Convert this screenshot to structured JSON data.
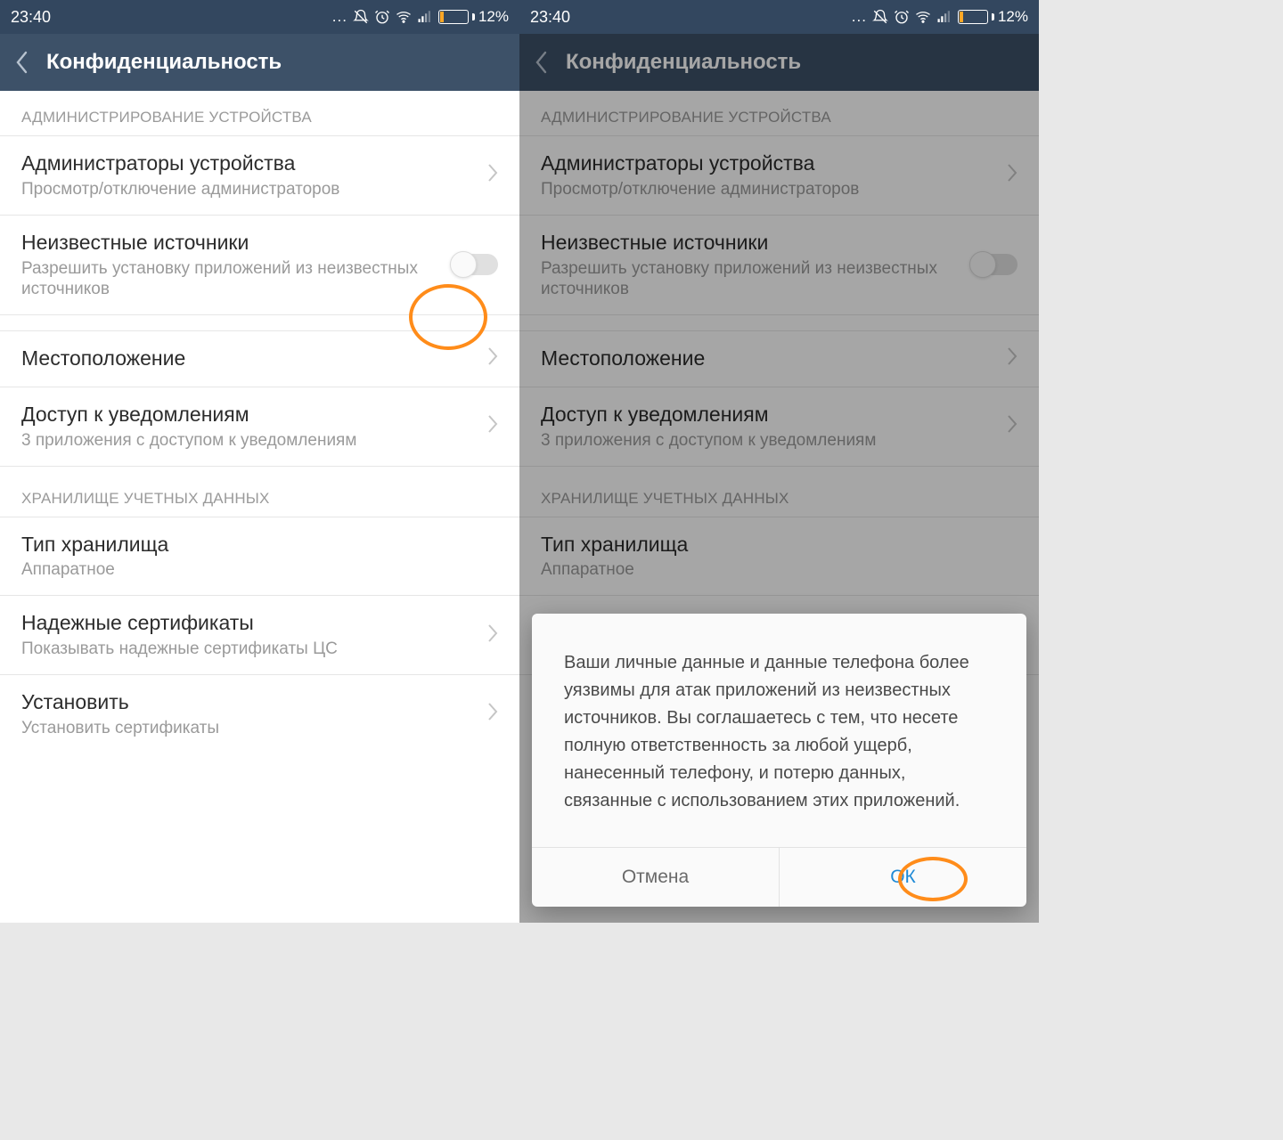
{
  "status": {
    "time": "23:40",
    "battery": "12%",
    "dots": "..."
  },
  "header": {
    "title": "Конфиденциальность"
  },
  "section1": "АДМИНИСТРИРОВАНИЕ УСТРОЙСТВА",
  "item_admins": {
    "title": "Администраторы устройства",
    "sub": "Просмотр/отключение администраторов"
  },
  "item_unknown": {
    "title": "Неизвестные источники",
    "sub": "Разрешить установку приложений из неизвестных источников"
  },
  "item_location": {
    "title": "Местоположение"
  },
  "item_notif": {
    "title": "Доступ к уведомлениям",
    "sub": "3 приложения с доступом к уведомлениям"
  },
  "section2": "ХРАНИЛИЩЕ УЧЕТНЫХ ДАННЫХ",
  "item_storage": {
    "title": "Тип хранилища",
    "sub": "Аппаратное"
  },
  "item_certs": {
    "title": "Надежные сертификаты",
    "sub": "Показывать надежные сертификаты ЦС"
  },
  "item_install": {
    "title": "Установить",
    "sub": "Установить сертификаты"
  },
  "dialog": {
    "body": "Ваши личные данные и данные телефона более уязвимы для атак приложений из неизвестных источников. Вы соглашаетесь с тем, что несете полную ответственность за любой ущерб, нанесенный телефону, и потерю данных, связанные с использованием этих приложений.",
    "cancel": "Отмена",
    "ok": "ОК"
  }
}
